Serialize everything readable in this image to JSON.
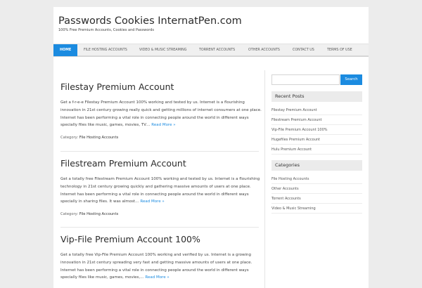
{
  "site": {
    "title": "Passwords Cookies InternatPen.com",
    "description": "100% Free Premium Accounts, Cookies and Passwords"
  },
  "nav": {
    "items": [
      {
        "label": "Home",
        "active": true
      },
      {
        "label": "File Hosting Accounts"
      },
      {
        "label": "Video & Music Streaming"
      },
      {
        "label": "Torrent Accounts"
      },
      {
        "label": "Other Accounts"
      },
      {
        "label": "Contact Us"
      },
      {
        "label": "Terms of Use"
      }
    ]
  },
  "posts": [
    {
      "title": "Filestay Premium Account",
      "lines": [
        "Get a f-r-e-e Filestay Premium Account 100% working and tested by us. Internet is a flourishing",
        "innovation in 21st century growing really quick and getting millions of internet consumers at one place.",
        "Internet has been performing a vital role in connecting people around the world in different ways",
        "specially files like music, games, movies, TV…"
      ],
      "read_more": "Read More »",
      "category_label": "Category:",
      "category": "File Hosting Accounts"
    },
    {
      "title": "Filestream Premium Account",
      "lines": [
        "Get a totally free Filestream Premium Account 100% working and tested by us. Internet is a flourishing",
        "technology in 21st century growing quickly and gathering massive amounts of users at one place.",
        "Internet has been performing a vital role in connecting people around the world in different ways",
        "specially in sharing files. It was almost…"
      ],
      "read_more": "Read More »",
      "category_label": "Category:",
      "category": "File Hosting Accounts"
    },
    {
      "title": "Vip-File Premium Account 100%",
      "lines": [
        "Get a totally free Vip-File Premium Account 100% working and verified by us. Internet is a growing",
        "innovation in 21st century spreading very fast and getting massive amounts of users at one place.",
        "Internet has been performing a vital role in connecting people around the world in different ways",
        "specially files like music, games, movies,…"
      ],
      "read_more": "Read More »"
    }
  ],
  "sidebar": {
    "search_button": "Search",
    "recent_posts_title": "Recent Posts",
    "recent_posts": [
      "Filestay Premium Account",
      "Filestream Premium Account",
      "Vip-File Premium Account 100%",
      "Hugefiles Premium Account",
      "Hulu Premium Account"
    ],
    "categories_title": "Categories",
    "categories": [
      "File Hosting Accounts",
      "Other Accounts",
      "Torrent Accounts",
      "Video & Music Streaming"
    ]
  },
  "colors": {
    "accent": "#1b8be0",
    "background": "#ececec"
  }
}
